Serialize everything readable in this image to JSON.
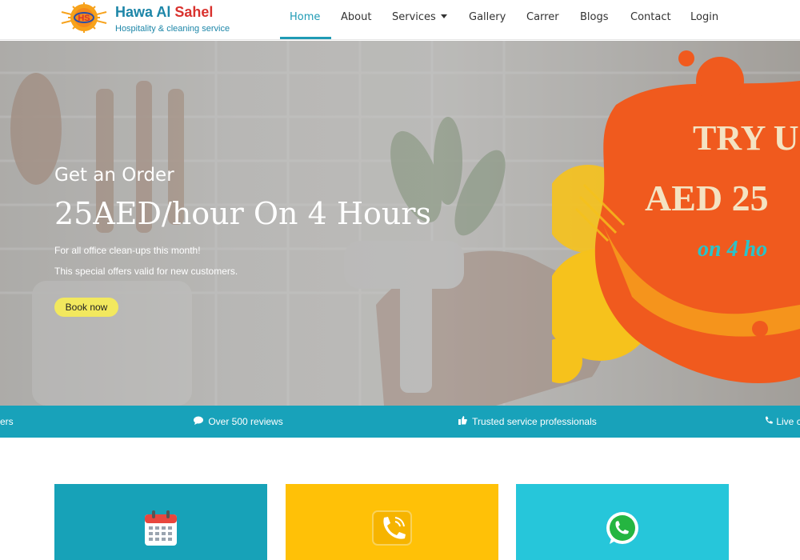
{
  "brand": {
    "name_part1": "Hawa Al",
    "name_part2": "Sahel",
    "tagline": "Hospitality & cleaning service",
    "logo_text": "HS"
  },
  "nav": {
    "items": [
      {
        "label": "Home",
        "active": true
      },
      {
        "label": "About"
      },
      {
        "label": "Services",
        "dropdown": true
      },
      {
        "label": "Gallery"
      },
      {
        "label": "Carrer"
      },
      {
        "label": "Blogs"
      },
      {
        "label": "Contact"
      },
      {
        "label": "Login"
      }
    ]
  },
  "hero": {
    "pre_title": "Get an Order",
    "title": "25AED/hour On 4 Hours",
    "line1": "For all office clean-ups this month!",
    "line2": "This special offers valid for new customers.",
    "cta": "Book now",
    "promo": {
      "line1": "TRY US",
      "line2": "AED 25",
      "line3": "on 4 ho"
    }
  },
  "ticker": {
    "items": [
      {
        "icon": "users-icon",
        "text": "ers"
      },
      {
        "icon": "comment-icon",
        "text": "Over 500 reviews"
      },
      {
        "icon": "thumbs-up-icon",
        "text": "Trusted service professionals"
      },
      {
        "icon": "phone-icon",
        "text": "Live cu"
      }
    ]
  },
  "cards": [
    {
      "icon": "calendar-icon",
      "color": "#17a2b8"
    },
    {
      "icon": "phone-call-icon",
      "color": "#ffc107"
    },
    {
      "icon": "whatsapp-icon",
      "color": "#26c6da"
    }
  ],
  "colors": {
    "primary": "#1f9bb5",
    "brand_red": "#d9322e",
    "ticker": "#18a2ba",
    "cta": "#f2e85e",
    "promo_orange": "#f05a1e",
    "promo_yellow": "#f6c21c"
  }
}
